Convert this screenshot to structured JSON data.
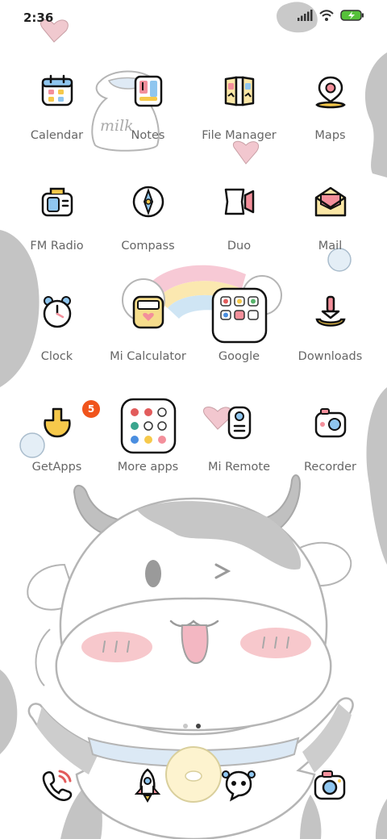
{
  "status_bar": {
    "time": "2:36",
    "icons": [
      "signal-icon",
      "wifi-icon",
      "battery-charging-icon"
    ]
  },
  "wallpaper": {
    "theme": "cartoon cow",
    "doodle_text": "milk",
    "colors": {
      "cow_spot": "#c2c2c2",
      "outline": "#b8b8b8",
      "blush": "#f7c5c8",
      "pink": "#f2c7cf"
    }
  },
  "apps": [
    {
      "label": "Calendar",
      "icon": "calendar-icon"
    },
    {
      "label": "Notes",
      "icon": "notes-icon"
    },
    {
      "label": "File Manager",
      "icon": "folder-icon"
    },
    {
      "label": "Maps",
      "icon": "map-pin-icon"
    },
    {
      "label": "FM Radio",
      "icon": "radio-icon"
    },
    {
      "label": "Compass",
      "icon": "compass-icon"
    },
    {
      "label": "Duo",
      "icon": "video-icon"
    },
    {
      "label": "Mail",
      "icon": "mail-icon"
    },
    {
      "label": "Clock",
      "icon": "clock-icon"
    },
    {
      "label": "Mi Calculator",
      "icon": "calculator-icon"
    },
    {
      "label": "Google",
      "icon": "google-folder-icon"
    },
    {
      "label": "Downloads",
      "icon": "download-icon"
    },
    {
      "label": "GetApps",
      "icon": "getapps-icon",
      "badge": "5"
    },
    {
      "label": "More apps",
      "icon": "more-apps-folder-icon"
    },
    {
      "label": "Mi Remote",
      "icon": "remote-icon"
    },
    {
      "label": "Recorder",
      "icon": "recorder-icon"
    }
  ],
  "page_indicator": {
    "pages": 2,
    "current": 2
  },
  "dock": [
    {
      "icon": "phone-icon"
    },
    {
      "icon": "rocket-icon"
    },
    {
      "icon": "messages-icon"
    },
    {
      "icon": "camera-icon"
    }
  ]
}
